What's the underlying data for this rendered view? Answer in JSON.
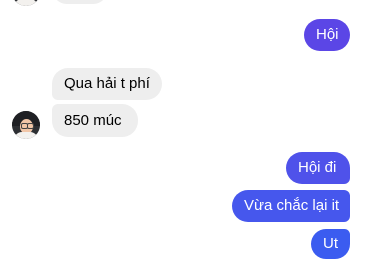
{
  "colors": {
    "incoming_bg": "#eeeeee",
    "outgoing_top": "#5b46e6",
    "outgoing_mid": "#4f52ea",
    "outgoing_bottom": "#3b5cf0"
  },
  "messages": [
    {
      "direction": "incoming",
      "text": "",
      "partial": true,
      "has_avatar": true
    },
    {
      "direction": "outgoing",
      "text": "Hội"
    },
    {
      "direction": "incoming",
      "text": "Qua hải t phí"
    },
    {
      "direction": "incoming",
      "text": "850 múc",
      "has_avatar": true
    },
    {
      "direction": "outgoing",
      "text": "Hội đi"
    },
    {
      "direction": "outgoing",
      "text": "Vừa chắc lại it"
    },
    {
      "direction": "outgoing",
      "text": "Ut"
    }
  ],
  "avatar_icon": "user-photo-avatar"
}
